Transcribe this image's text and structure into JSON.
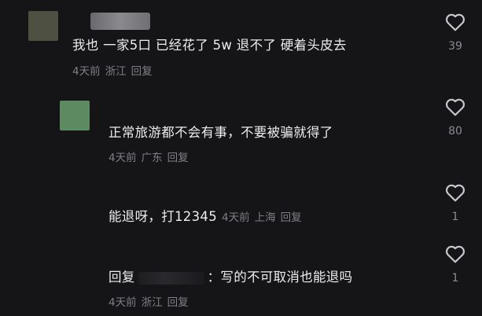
{
  "comments": [
    {
      "text": "我也 一家5口 已经花了 5w 退不了 硬着头皮去",
      "time": "4天前",
      "location": "浙江",
      "reply": "回复",
      "likes": "39"
    },
    {
      "text": "正常旅游都不会有事，不要被骗就得了",
      "time": "4天前",
      "location": "广东",
      "reply": "回复",
      "likes": "80"
    },
    {
      "text": "能退呀，打12345",
      "time": "4天前",
      "location": "上海",
      "reply": "回复",
      "likes": "1"
    },
    {
      "reply_prefix": "回复",
      "text": "：写的不可取消也能退吗",
      "time": "4天前",
      "location": "浙江",
      "reply": "回复",
      "likes": "1"
    }
  ],
  "colors": {
    "background": "#151517",
    "text": "#ededef",
    "meta": "#7e7e84",
    "avatar1": "#4e5042",
    "avatar2": "#5d8a60"
  },
  "icons": {
    "like": "heart-outline-icon"
  }
}
